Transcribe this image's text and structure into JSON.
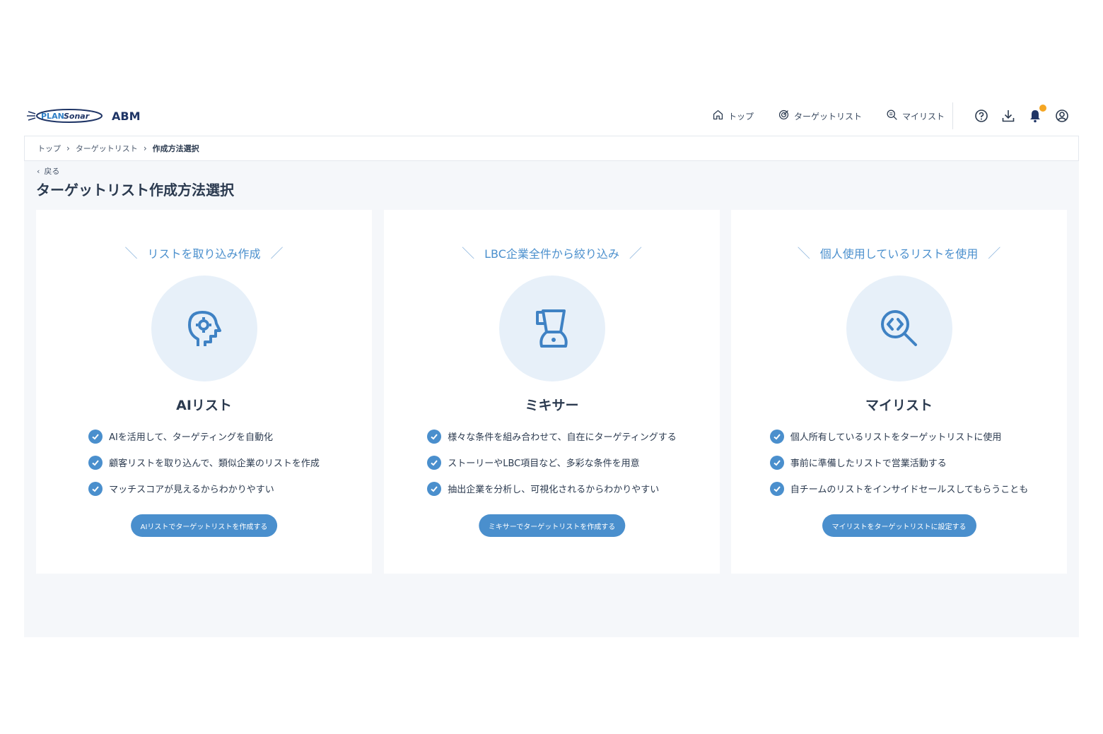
{
  "header": {
    "app_name": "ABM",
    "logo_text": "PLANSonar",
    "nav": [
      {
        "label": "トップ",
        "icon": "home-icon"
      },
      {
        "label": "ターゲットリスト",
        "icon": "target-icon"
      },
      {
        "label": "マイリスト",
        "icon": "search-list-icon"
      }
    ],
    "tools": [
      "help-icon",
      "download-icon",
      "bell-icon",
      "user-icon"
    ],
    "notification_color": "#f5a623"
  },
  "breadcrumb": [
    "トップ",
    "ターゲットリスト",
    "作成方法選択"
  ],
  "back_label": "戻る",
  "page_title": "ターゲットリスト作成方法選択",
  "cards": [
    {
      "tagline": "リストを取り込み作成",
      "icon": "ai-head-icon",
      "title": "AIリスト",
      "features": [
        "AIを活用して、ターゲティングを自動化",
        "顧客リストを取り込んで、類似企業のリストを作成",
        "マッチスコアが見えるからわかりやすい"
      ],
      "button": "AIリストでターゲットリストを作成する"
    },
    {
      "tagline": "LBC企業全件から絞り込み",
      "icon": "blender-icon",
      "title": "ミキサー",
      "features": [
        "様々な条件を組み合わせて、自在にターゲティングする",
        "ストーリーやLBC項目など、多彩な条件を用意",
        "抽出企業を分析し、可視化されるからわかりやすい"
      ],
      "button": "ミキサーでターゲットリストを作成する"
    },
    {
      "tagline": "個人使用しているリストを使用",
      "icon": "code-search-icon",
      "title": "マイリスト",
      "features": [
        "個人所有しているリストをターゲットリストに使用",
        "事前に準備したリストで営業活動する",
        "自チームのリストをインサイドセールスしてもらうことも"
      ],
      "button": "マイリストをターゲットリストに設定する"
    }
  ],
  "colors": {
    "accent": "#4a8fcd",
    "icon_bg": "#e7f0f9",
    "page_bg": "#f5f7fa",
    "brand_navy": "#1f3566"
  }
}
